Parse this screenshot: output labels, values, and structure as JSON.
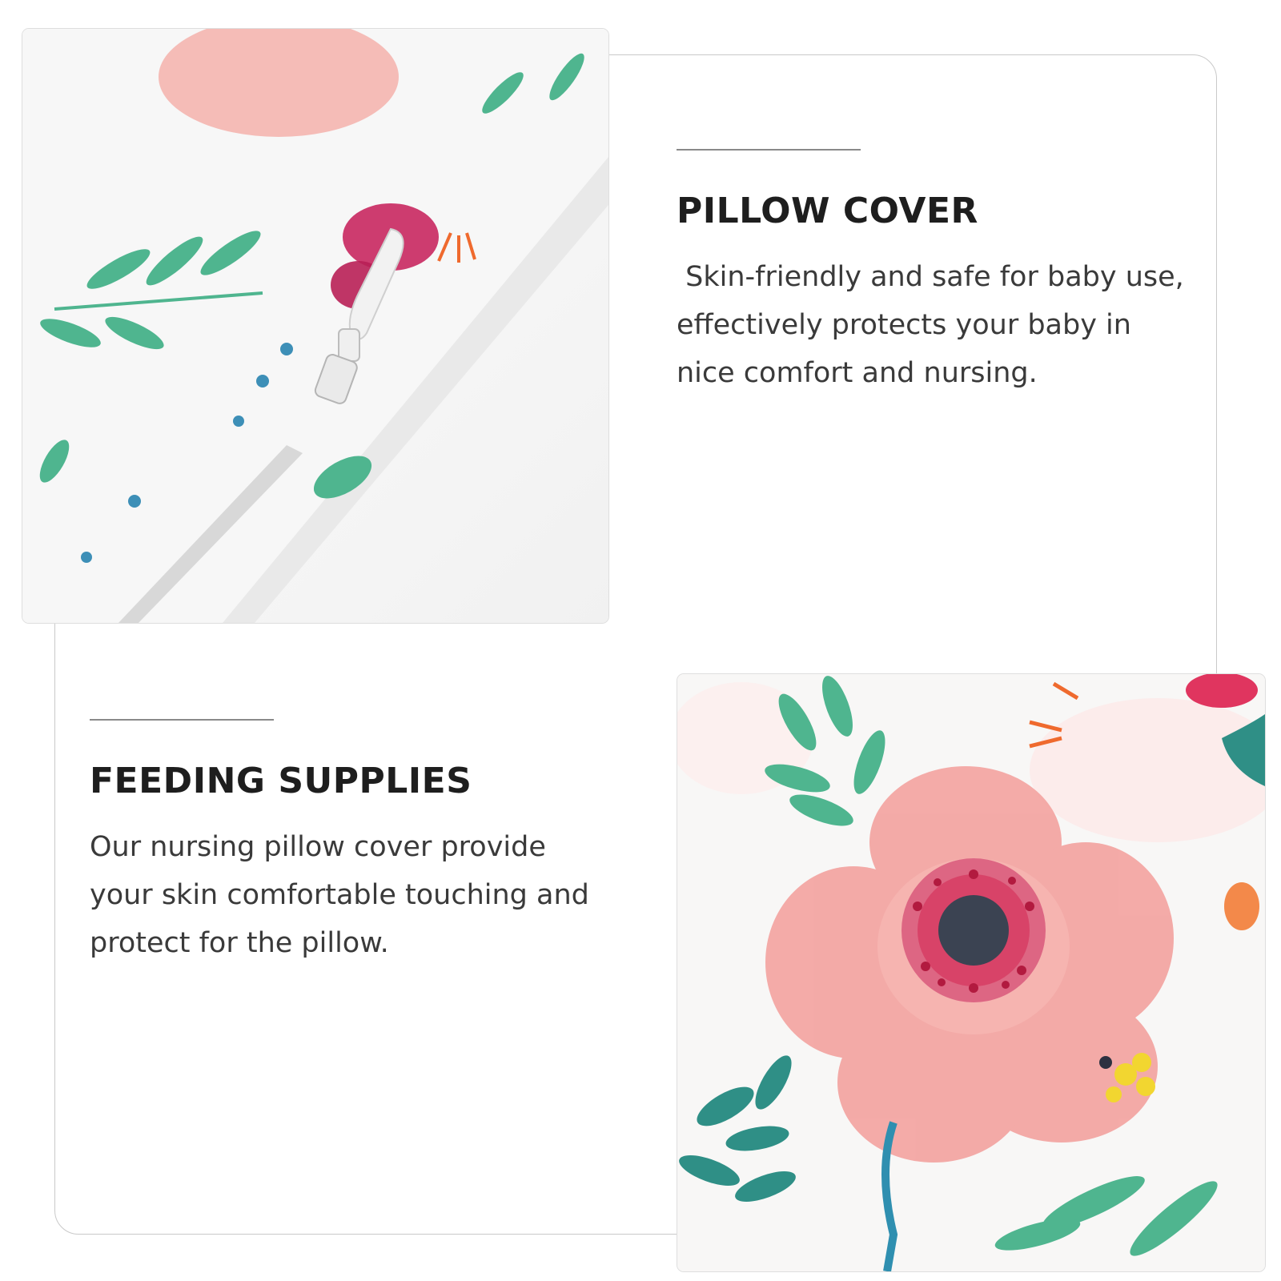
{
  "sections": [
    {
      "title": "PILLOW COVER",
      "body": " Skin-friendly and safe for baby use,\neffectively protects your baby in\nnice comfort and nursing."
    },
    {
      "title": "FEEDING SUPPLIES",
      "body": "Our nursing pillow cover provide\nyour skin comfortable touching and\nprotect for the pillow."
    }
  ],
  "colors": {
    "title": "#1e1e1e",
    "body": "#3a3a3a",
    "frame": "#c9c9c9",
    "petal_pink": "#f3a6a3",
    "leaf_green": "#4fb58f",
    "accent_magenta": "#c8275f"
  },
  "images": {
    "top": "floral-pillow-cover-zipper-closeup",
    "bottom": "floral-fabric-pink-poppy-closeup"
  }
}
